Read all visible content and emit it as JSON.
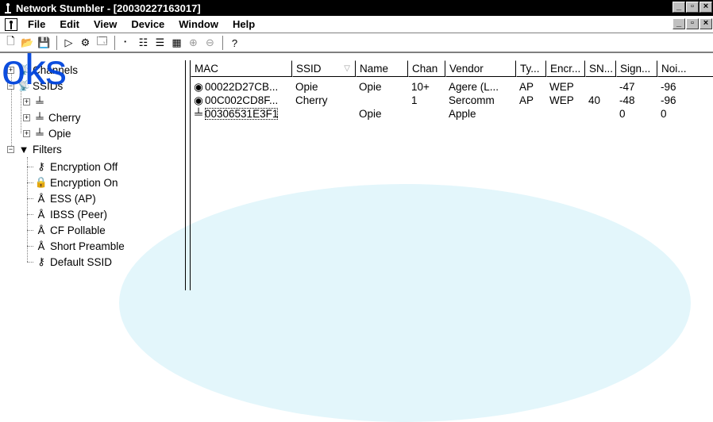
{
  "window": {
    "title": "Network Stumbler - [20030227163017]",
    "buttons": [
      "_",
      "̅",
      "×"
    ]
  },
  "menubar": {
    "items": [
      "File",
      "Edit",
      "View",
      "Device",
      "Window",
      "Help"
    ]
  },
  "toolbar": {
    "icons": [
      "new-icon",
      "open-icon",
      "save-icon",
      "play-icon",
      "scan-options-icon",
      "properties-icon",
      "small-icons-icon",
      "list-icon",
      "details-icon",
      "report-icon",
      "zoom-in-icon",
      "zoom-out-icon",
      "help-icon"
    ]
  },
  "watermark": {
    "text": "oks"
  },
  "tree": {
    "channels_label": "Channels",
    "ssids_label": "SSIDs",
    "ssid_children": [
      "",
      "Cherry",
      "Opie"
    ],
    "filters_label": "Filters",
    "filter_children": [
      "Encryption Off",
      "Encryption On",
      "ESS (AP)",
      "IBSS (Peer)",
      "CF Pollable",
      "Short Preamble",
      "Default SSID"
    ]
  },
  "list": {
    "columns": [
      "MAC",
      "SSID",
      "Name",
      "Chan",
      "Vendor",
      "Ty...",
      "Encr...",
      "SN...",
      "Sign...",
      "Noi..."
    ],
    "rows": [
      [
        "00022D27CB...",
        "Opie",
        "Opie",
        "10+",
        "Agere (L...",
        "AP",
        "WEP",
        "",
        "-47",
        "-96"
      ],
      [
        "00C002CD8F...",
        "Cherry",
        "",
        "1",
        "Sercomm",
        "AP",
        "WEP",
        "40",
        "-48",
        "-96"
      ],
      [
        "00306531E3F1",
        "",
        "Opie",
        "",
        "Apple",
        "",
        "",
        "",
        "0",
        "0"
      ]
    ]
  }
}
